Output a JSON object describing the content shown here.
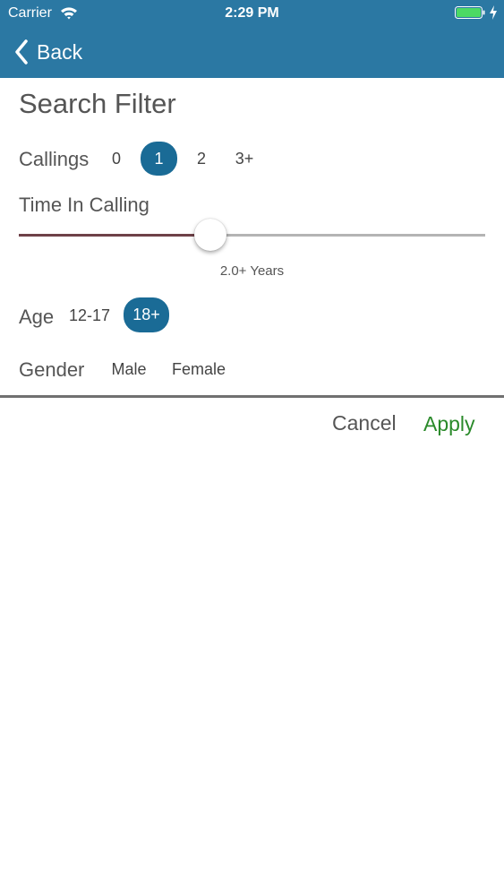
{
  "status_bar": {
    "carrier": "Carrier",
    "time": "2:29 PM"
  },
  "nav": {
    "back_label": "Back"
  },
  "page": {
    "title": "Search Filter"
  },
  "filters": {
    "callings": {
      "label": "Callings",
      "options": [
        "0",
        "1",
        "2",
        "3+"
      ],
      "selected": "1"
    },
    "time_in_calling": {
      "label": "Time In Calling",
      "value_text": "2.0+ Years",
      "fraction": 0.41
    },
    "age": {
      "label": "Age",
      "options": [
        "12-17",
        "18+"
      ],
      "selected": "18+"
    },
    "gender": {
      "label": "Gender",
      "options": [
        "Male",
        "Female"
      ]
    }
  },
  "actions": {
    "cancel": "Cancel",
    "apply": "Apply"
  },
  "colors": {
    "header": "#2b78a3",
    "selected_pill": "#1a6b96",
    "apply": "#2a8a2a",
    "slider_fill": "#6e4148",
    "slider_track": "#b4b4b4",
    "battery": "#4cd964"
  },
  "icons": [
    "wifi-icon",
    "battery-icon",
    "charging-bolt-icon",
    "chevron-left-icon"
  ]
}
